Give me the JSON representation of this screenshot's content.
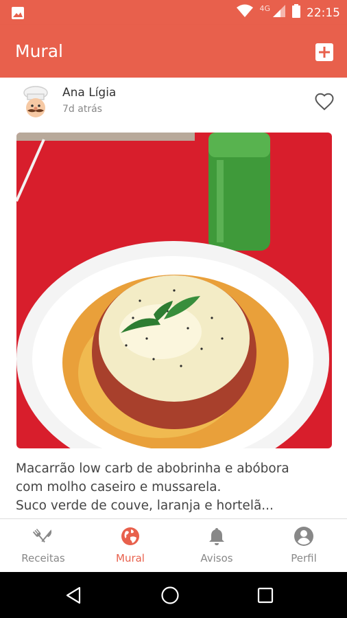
{
  "status_bar": {
    "network_label": "4G",
    "time": "22:15",
    "icons": [
      "image-icon",
      "wifi-icon",
      "signal-icon",
      "battery-icon"
    ]
  },
  "app_bar": {
    "title": "Mural",
    "action_icon": "add-box-icon"
  },
  "post": {
    "author": "Ana Lígia",
    "time_ago": "7d atrás",
    "liked": false,
    "caption": "Macarrão low carb de abobrinha e abóbora\ncom molho caseiro e mussarela.\nSuco verde de couve, laranja e hortelã..."
  },
  "bottom_nav": {
    "active": "Mural",
    "items": [
      {
        "label": "Receitas",
        "icon": "fork-knife-icon"
      },
      {
        "label": "Mural",
        "icon": "globe-icon"
      },
      {
        "label": "Avisos",
        "icon": "bell-icon"
      },
      {
        "label": "Perfil",
        "icon": "account-circle-icon"
      }
    ]
  },
  "colors": {
    "accent": "#E8604C",
    "inactive": "#888888"
  }
}
